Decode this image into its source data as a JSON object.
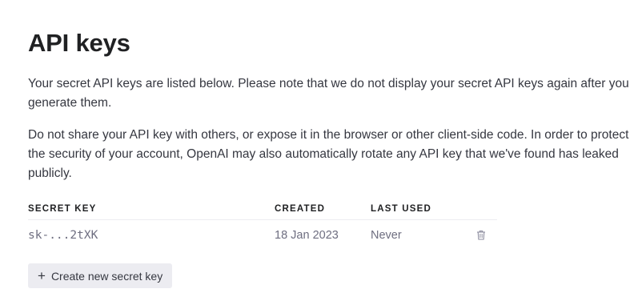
{
  "page": {
    "title": "API keys",
    "description_1": "Your secret API keys are listed below. Please note that we do not display your secret API keys again after you generate them.",
    "description_2": "Do not share your API key with others, or expose it in the browser or other client-side code. In order to protect the security of your account, OpenAI may also automatically rotate any API key that we've found has leaked publicly."
  },
  "table": {
    "headers": [
      "SECRET KEY",
      "CREATED",
      "LAST USED"
    ],
    "rows": [
      {
        "key": "sk-...2tXK",
        "created": "18 Jan 2023",
        "last_used": "Never"
      }
    ]
  },
  "actions": {
    "create_label": "Create new secret key",
    "create_icon": "+"
  },
  "icons": {
    "delete": "trash-icon"
  },
  "colors": {
    "heading": "#202123",
    "text": "#353740",
    "muted": "#6e6e80",
    "button_bg": "#ececf1",
    "divider": "#ececf1"
  }
}
